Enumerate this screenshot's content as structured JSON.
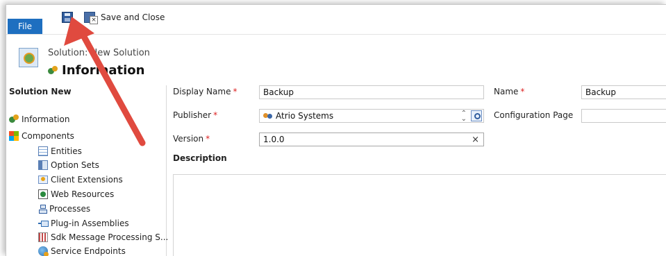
{
  "ribbon": {
    "file_label": "File",
    "save_close_label": "Save and Close"
  },
  "header": {
    "breadcrumb": "Solution: New Solution",
    "title": "Information"
  },
  "nav": {
    "title": "Solution New",
    "items": [
      {
        "label": "Information",
        "icon": "gears-icon"
      },
      {
        "label": "Components",
        "icon": "components-icon"
      }
    ],
    "sub_items": [
      {
        "label": "Entities",
        "icon": "entities-icon"
      },
      {
        "label": "Option Sets",
        "icon": "option-sets-icon"
      },
      {
        "label": "Client Extensions",
        "icon": "client-extensions-icon"
      },
      {
        "label": "Web Resources",
        "icon": "web-resources-icon"
      },
      {
        "label": "Processes",
        "icon": "processes-icon"
      },
      {
        "label": "Plug-in Assemblies",
        "icon": "plugin-assemblies-icon"
      },
      {
        "label": "Sdk Message Processing S...",
        "icon": "sdk-message-icon"
      },
      {
        "label": "Service Endpoints",
        "icon": "service-endpoints-icon"
      }
    ]
  },
  "form": {
    "display_name_label": "Display Name",
    "display_name_value": "Backup",
    "name_label": "Name",
    "name_value": "Backup",
    "publisher_label": "Publisher",
    "publisher_value": "Atrio Systems",
    "config_page_label": "Configuration Page",
    "config_page_value": "",
    "version_label": "Version",
    "version_value": "1.0.0",
    "description_label": "Description",
    "required_mark": "*",
    "clear_glyph": "×"
  },
  "annotation": {
    "arrow_color": "#e04a3f"
  }
}
